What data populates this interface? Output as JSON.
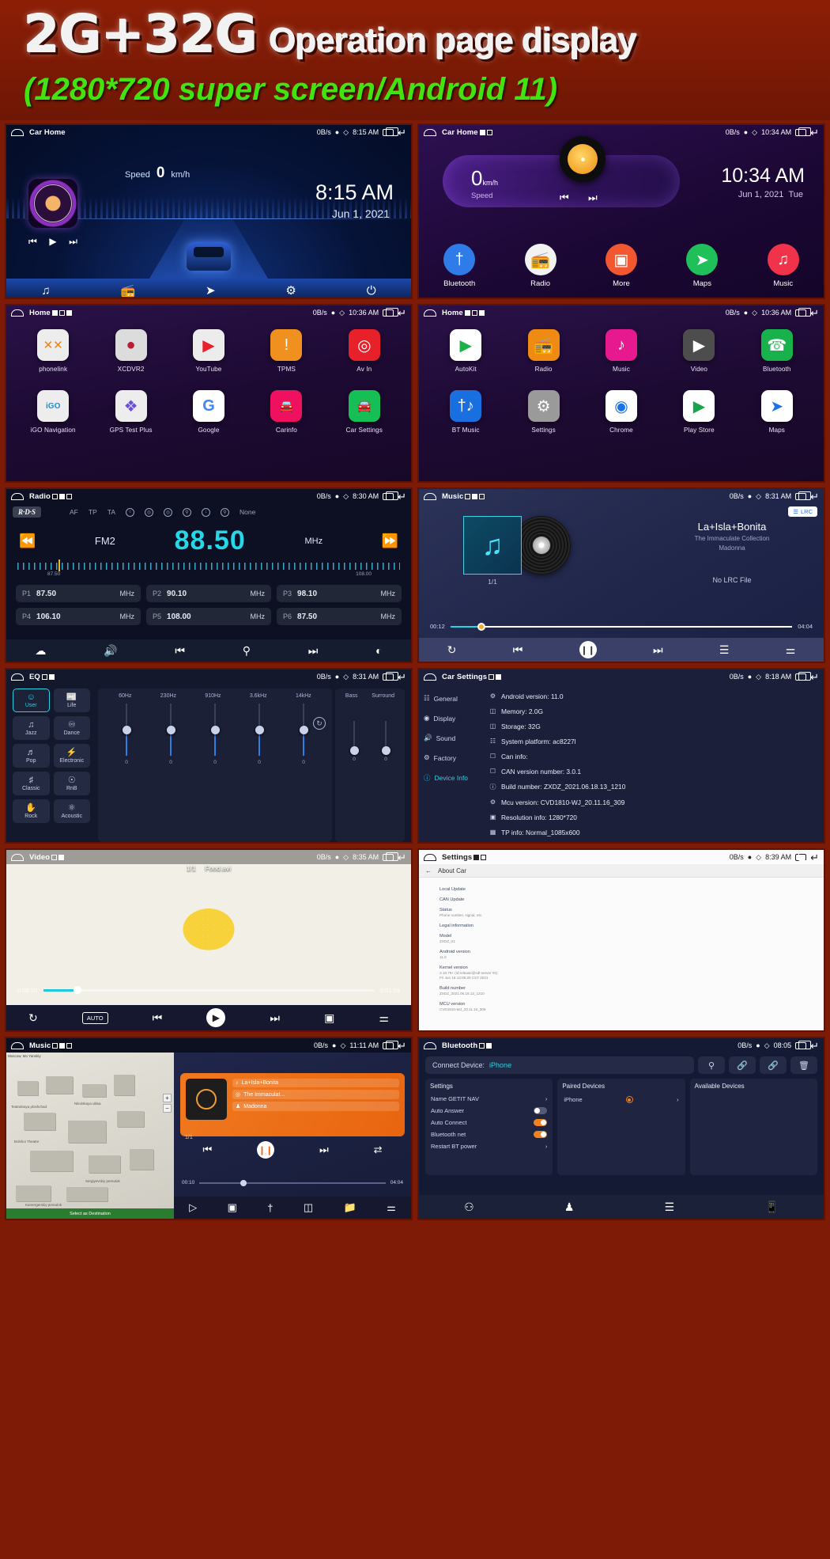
{
  "banner": {
    "title_big": "2G+32G",
    "title_rest": "Operation page display",
    "subtitle": "(1280*720 super screen/Android 11)"
  },
  "panels": {
    "car_home_blue": {
      "status": {
        "title": "Car Home",
        "net": "0B/s",
        "time": "8:15 AM"
      },
      "speed_label": "Speed",
      "speed_value": "0",
      "speed_unit": "km/h",
      "clock": "8:15 AM",
      "date": "Jun 1, 2021",
      "dock": [
        "music-note-icon",
        "radio-icon",
        "navigation-icon",
        "gear-icon",
        "power-icon"
      ]
    },
    "car_home_purple": {
      "status": {
        "title": "Car Home",
        "net": "0B/s",
        "time": "10:34 AM"
      },
      "speed_value": "0",
      "speed_unit": "km/h",
      "speed_label": "Speed",
      "clock": "10:34 AM",
      "date": "Jun 1, 2021",
      "weekday": "Tue",
      "apps": [
        {
          "label": "Bluetooth",
          "icon": "bluetooth-icon",
          "color": "#2f7ce8"
        },
        {
          "label": "Radio",
          "icon": "radio-icon",
          "color": "#f0f0f0"
        },
        {
          "label": "More",
          "icon": "grid-icon",
          "color": "#f2572f"
        },
        {
          "label": "Maps",
          "icon": "navigation-icon",
          "color": "#1fbf5a"
        },
        {
          "label": "Music",
          "icon": "music-note-icon",
          "color": "#f0324b"
        }
      ]
    },
    "drawer_left": {
      "status": {
        "title": "Home",
        "net": "0B/s",
        "time": "10:36 AM"
      },
      "apps": [
        {
          "label": "phonelink",
          "icon": "phonelink-icon",
          "color": "#ededed",
          "glyph": "✕✕",
          "fg": "#e8861b"
        },
        {
          "label": "XCDVR2",
          "icon": "dashcam-icon",
          "color": "#d8d8d8",
          "glyph": "●",
          "fg": "#b81e36"
        },
        {
          "label": "YouTube",
          "icon": "youtube-icon",
          "color": "#ececec",
          "glyph": "▶",
          "fg": "#e8202a"
        },
        {
          "label": "TPMS",
          "icon": "tpms-icon",
          "color": "#d8d8d8",
          "glyph": "!",
          "fg": "#f0911f"
        },
        {
          "label": "Av In",
          "icon": "avin-icon",
          "color": "#e8202a",
          "glyph": "◎",
          "fg": "#ffffff"
        },
        {
          "label": "iGO Navigation",
          "icon": "igo-icon",
          "color": "#ededed",
          "glyph": "iGO",
          "fg": "#1a8fd8"
        },
        {
          "label": "GPS Test Plus",
          "icon": "gps-test-icon",
          "color": "#ededed",
          "glyph": "✦",
          "fg": "#6c4fd8"
        },
        {
          "label": "Google",
          "icon": "google-icon",
          "color": "#ffffff",
          "glyph": "G",
          "fg": "#4285f4"
        },
        {
          "label": "Carinfo",
          "icon": "car-icon",
          "color": "#ef1060",
          "glyph": "🚗",
          "fg": "#ffffff"
        },
        {
          "label": "Car Settings",
          "icon": "car-settings-icon",
          "color": "#16bf55",
          "glyph": "🚗",
          "fg": "#ffffff"
        }
      ]
    },
    "drawer_right": {
      "status": {
        "title": "Home",
        "net": "0B/s",
        "time": "10:36 AM"
      },
      "apps": [
        {
          "label": "AutoKit",
          "icon": "autokit-icon",
          "color": "#ffffff",
          "glyph": "▶",
          "fg": "#19b34a"
        },
        {
          "label": "Radio",
          "icon": "radio-icon",
          "color": "#ef8a12",
          "glyph": "📻",
          "fg": "#ffffff"
        },
        {
          "label": "Music",
          "icon": "music-note-icon",
          "color": "#e6198f",
          "glyph": "♪",
          "fg": "#ffffff"
        },
        {
          "label": "Video",
          "icon": "video-icon",
          "color": "#4d4d4d",
          "glyph": "▶",
          "fg": "#ffffff"
        },
        {
          "label": "Bluetooth",
          "icon": "bluetooth-icon",
          "color": "#18b24c",
          "glyph": "✆",
          "fg": "#ffffff"
        },
        {
          "label": "BT Music",
          "icon": "bt-music-icon",
          "color": "#1a6fe0",
          "glyph": "♪",
          "fg": "#ffffff"
        },
        {
          "label": "Settings",
          "icon": "gear-icon",
          "color": "#9a9a9a",
          "glyph": "⚙",
          "fg": "#ffffff"
        },
        {
          "label": "Chrome",
          "icon": "chrome-icon",
          "color": "#ffffff",
          "glyph": "●",
          "fg": "#1a73e8"
        },
        {
          "label": "Play Store",
          "icon": "play-store-icon",
          "color": "#ffffff",
          "glyph": "▶",
          "fg": "#1aa34a"
        },
        {
          "label": "Maps",
          "icon": "maps-icon",
          "color": "#ffffff",
          "glyph": "➤",
          "fg": "#1a73e8"
        }
      ]
    },
    "radio": {
      "status": {
        "title": "Radio",
        "net": "0B/s",
        "time": "8:30 AM"
      },
      "rds_badge": "R·D·S",
      "rds_items": [
        "AF",
        "TP",
        "TA"
      ],
      "rds_none": "None",
      "band": "FM2",
      "frequency": "88.50",
      "unit": "MHz",
      "dial_min": "87.50",
      "dial_max": "108.00",
      "presets": [
        {
          "n": "P1",
          "v": "87.50",
          "u": "MHz"
        },
        {
          "n": "P2",
          "v": "90.10",
          "u": "MHz"
        },
        {
          "n": "P3",
          "v": "98.10",
          "u": "MHz"
        },
        {
          "n": "P4",
          "v": "106.10",
          "u": "MHz"
        },
        {
          "n": "P5",
          "v": "108.00",
          "u": "MHz"
        },
        {
          "n": "P6",
          "v": "87.50",
          "u": "MHz"
        }
      ],
      "dock": [
        "rds-icon",
        "mute-icon",
        "previous-icon",
        "search-icon",
        "next-icon",
        "band-icon"
      ]
    },
    "music": {
      "status": {
        "title": "Music",
        "net": "0B/s",
        "time": "8:31 AM"
      },
      "lrc_label": "LRC",
      "index": "1/1",
      "track_title": "La+Isla+Bonita",
      "album": "The Immaculate Collection",
      "artist": "Madonna",
      "no_lrc": "No LRC File",
      "time_elapsed": "00:12",
      "time_total": "04:04",
      "dock": [
        "repeat-icon",
        "previous-icon",
        "pause-icon",
        "next-icon",
        "playlist-icon",
        "equalizer-icon"
      ]
    },
    "eq": {
      "status": {
        "title": "EQ",
        "net": "0B/s",
        "time": "8:31 AM"
      },
      "presets": [
        {
          "label": "User",
          "icon": "user-icon",
          "selected": true
        },
        {
          "label": "Life",
          "icon": "news-icon",
          "selected": false
        },
        {
          "label": "Jazz",
          "icon": "jazz-icon",
          "selected": false
        },
        {
          "label": "Dance",
          "icon": "dance-icon",
          "selected": false
        },
        {
          "label": "Pop",
          "icon": "pop-icon",
          "selected": false
        },
        {
          "label": "Electronic",
          "icon": "electronic-icon",
          "selected": false
        },
        {
          "label": "Classic",
          "icon": "classic-icon",
          "selected": false
        },
        {
          "label": "RnB",
          "icon": "rnb-icon",
          "selected": false
        },
        {
          "label": "Rock",
          "icon": "rock-icon",
          "selected": false
        },
        {
          "label": "Acoustic",
          "icon": "acoustic-icon",
          "selected": false
        }
      ],
      "bands": [
        "60Hz",
        "230Hz",
        "910Hz",
        "3.6kHz",
        "14kHz"
      ],
      "band_values": [
        "0",
        "0",
        "0",
        "0",
        "0"
      ],
      "extra_labels": [
        "Bass",
        "Surround"
      ],
      "extra_values": [
        "0",
        "0"
      ]
    },
    "car_settings": {
      "status": {
        "title": "Car Settings",
        "net": "0B/s",
        "time": "8:18 AM"
      },
      "nav": [
        {
          "label": "General",
          "icon": "general-icon",
          "selected": false
        },
        {
          "label": "Display",
          "icon": "display-icon",
          "selected": false
        },
        {
          "label": "Sound",
          "icon": "sound-icon",
          "selected": false
        },
        {
          "label": "Factory",
          "icon": "factory-icon",
          "selected": false
        },
        {
          "label": "Device Info",
          "icon": "info-icon",
          "selected": true
        }
      ],
      "info": [
        "Android version:  11.0",
        "Memory:  2.0G",
        "Storage:  32G",
        "System platform:  ac8227l",
        "Can info:",
        "CAN version number:  3.0.1",
        "Build number:  ZXDZ_2021.06.18.13_1210",
        "Mcu version:  CVD1810-WJ_20.11.16_309",
        "Resolution info:  1280*720",
        "TP info:  Normal_1085x600"
      ]
    },
    "video": {
      "status": {
        "title": "Video",
        "net": "0B/s",
        "time": "8:35 AM"
      },
      "index": "1/1",
      "filename": "Food.avi",
      "time_elapsed": "0:00:10",
      "time_total": "0:01:59",
      "auto_label": "AUTO",
      "dock": [
        "repeat-icon",
        "auto-button",
        "previous-icon",
        "play-icon",
        "next-icon",
        "screen-icon",
        "equalizer-icon"
      ]
    },
    "about": {
      "status": {
        "title": "Settings",
        "net": "0B/s",
        "time": "8:39 AM"
      },
      "header": "About Car",
      "rows": [
        {
          "title": "Local Update",
          "sub": ""
        },
        {
          "title": "CAN Update",
          "sub": ""
        },
        {
          "title": "Status",
          "sub": "Phone number, signal, etc."
        },
        {
          "title": "Legal information",
          "sub": ""
        },
        {
          "title": "Model",
          "sub": "ZXDZ_01"
        },
        {
          "title": "Android version",
          "sub": "11.0"
        },
        {
          "title": "Kernel version",
          "sub": "3.18.79+ (id:release@sdl-server #2)\nFri Jun 18 13:06:20 CST 2021"
        },
        {
          "title": "Build number",
          "sub": "ZXDZ_2021.06.18.13_1210"
        },
        {
          "title": "MCU version",
          "sub": "CVD1810-WJ_20.11.16_309"
        }
      ]
    },
    "music_map": {
      "status": {
        "title": "Music",
        "net": "0B/s",
        "time": "11:11 AM"
      },
      "map_top": "Moscow, Mo Yanskiy",
      "map_button": "Select as Destination",
      "map_labels": [
        "Teatralnaya ploshchad",
        "Nikolskaya ulitsa",
        "Bolshoi Theatre",
        "Sergiyevskiy pereulok",
        "Kamergerskiy pereulok"
      ],
      "index": "1/1",
      "track_title": "La+Isla+Bonita",
      "album": "The Immaculat...",
      "artist": "Madonna",
      "time_elapsed": "00:10",
      "time_total": "04:04"
    },
    "bluetooth": {
      "status": {
        "title": "Bluetooth",
        "net": "0B/s",
        "time": "08:05"
      },
      "connect_label": "Connect Device:",
      "connect_value": "iPhone",
      "top_icons": [
        "search-icon",
        "link-icon",
        "unlink-icon",
        "delete-icon"
      ],
      "settings_title": "Settings",
      "settings": [
        {
          "label": "Name  GETIT NAV",
          "toggle": null
        },
        {
          "label": "Auto Answer",
          "toggle": "off"
        },
        {
          "label": "Auto Connect",
          "toggle": "on"
        },
        {
          "label": "Bluetooth net",
          "toggle": "on"
        },
        {
          "label": "Restart BT power",
          "toggle": null
        }
      ],
      "paired_title": "Paired Devices",
      "paired": [
        "iPhone"
      ],
      "available_title": "Available Devices",
      "available": [],
      "dock": [
        "dialpad-icon",
        "contacts-icon",
        "call-log-icon",
        "phone-transfer-icon"
      ]
    }
  }
}
